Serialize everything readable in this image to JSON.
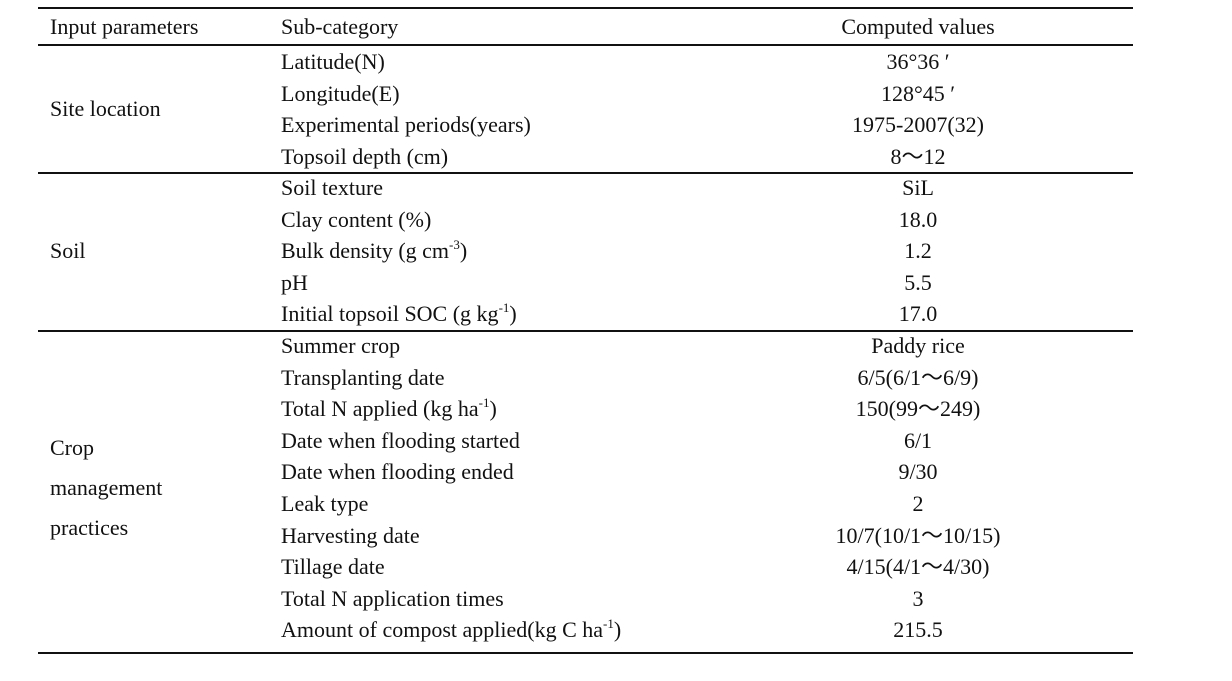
{
  "table": {
    "headers": [
      "Input parameters",
      "Sub-category",
      "Computed values"
    ],
    "groups": [
      {
        "label_lines": [
          "Site location"
        ],
        "rows": [
          {
            "sub": "Latitude(N)",
            "sup": "",
            "sub_tail": "",
            "value": "36°36 ′"
          },
          {
            "sub": "Longitude(E)",
            "sup": "",
            "sub_tail": "",
            "value": "128°45 ′"
          },
          {
            "sub": "Experimental periods(years)",
            "sup": "",
            "sub_tail": "",
            "value": "1975-2007(32)"
          },
          {
            "sub": "Topsoil depth (cm)",
            "sup": "",
            "sub_tail": "",
            "value": "8～12"
          }
        ]
      },
      {
        "label_lines": [
          "Soil"
        ],
        "rows": [
          {
            "sub": "Soil texture",
            "sup": "",
            "sub_tail": "",
            "value": "SiL"
          },
          {
            "sub": "Clay content (%)",
            "sup": "",
            "sub_tail": "",
            "value": "18.0"
          },
          {
            "sub": "Bulk density (g cm",
            "sup": "-3",
            "sub_tail": ")",
            "value": "1.2"
          },
          {
            "sub": "pH",
            "sup": "",
            "sub_tail": "",
            "value": "5.5"
          },
          {
            "sub": "Initial topsoil SOC (g kg",
            "sup": "-1",
            "sub_tail": ")",
            "value": "17.0"
          }
        ]
      },
      {
        "label_lines": [
          "Crop",
          "management",
          "practices"
        ],
        "rows": [
          {
            "sub": "Summer crop",
            "sup": "",
            "sub_tail": "",
            "value": "Paddy rice"
          },
          {
            "sub": "Transplanting date",
            "sup": "",
            "sub_tail": "",
            "value": "6/5(6/1～6/9)"
          },
          {
            "sub": "Total N applied (kg ha",
            "sup": "-1",
            "sub_tail": ")",
            "value": "150(99～249)"
          },
          {
            "sub": "Date when flooding started",
            "sup": "",
            "sub_tail": "",
            "value": "6/1"
          },
          {
            "sub": "Date when flooding ended",
            "sup": "",
            "sub_tail": "",
            "value": "9/30"
          },
          {
            "sub": "Leak type",
            "sup": "",
            "sub_tail": "",
            "value": "2"
          },
          {
            "sub": "Harvesting date",
            "sup": "",
            "sub_tail": "",
            "value": "10/7(10/1～10/15)"
          },
          {
            "sub": "Tillage date",
            "sup": "",
            "sub_tail": "",
            "value": "4/15(4/1～4/30)"
          },
          {
            "sub": "Total N application times",
            "sup": "",
            "sub_tail": "",
            "value": "3"
          },
          {
            "sub": "Amount of compost applied(kg C ha",
            "sup": "-1",
            "sub_tail": ")",
            "value": "215.5"
          }
        ]
      }
    ]
  }
}
